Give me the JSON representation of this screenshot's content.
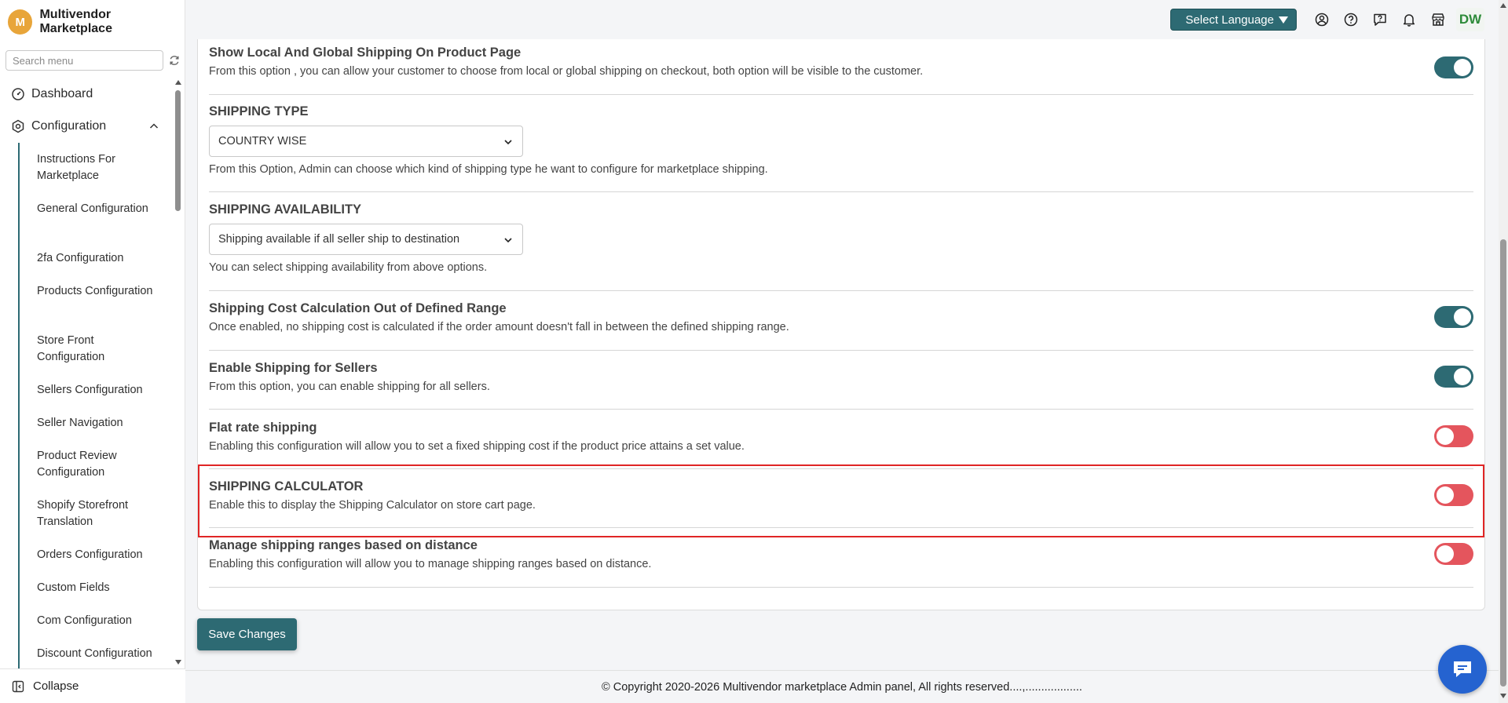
{
  "brand": {
    "logo_letter": "M",
    "name": "Multivendor Marketplace"
  },
  "sidebar": {
    "search_placeholder": "Search menu",
    "dashboard": "Dashboard",
    "configuration": "Configuration",
    "sub_items": [
      "Instructions For Marketplace",
      "General Configuration",
      "2fa Configuration",
      "Products Configuration",
      "Store Front Configuration",
      "Sellers Configuration",
      "Seller Navigation",
      "Product Review Configuration",
      "Shopify Storefront Translation",
      "Orders Configuration",
      "Custom Fields",
      "Com Configuration",
      "Discount Configuration"
    ],
    "collapse": "Collapse"
  },
  "topbar": {
    "language_button": "Select Language",
    "user_initials": "DW",
    "icons": [
      "user-circle-icon",
      "help-circle-icon",
      "support-chat-icon",
      "bell-icon",
      "store-icon"
    ]
  },
  "settings": {
    "local_global": {
      "title": "Show Local And Global Shipping On Product Page",
      "desc": "From this option , you can allow your customer to choose from local or global shipping on checkout, both option will be visible to the customer.",
      "enabled": true
    },
    "shipping_type": {
      "title": "SHIPPING TYPE",
      "value": "COUNTRY WISE",
      "desc": "From this Option, Admin can choose which kind of shipping type he want to configure for marketplace shipping."
    },
    "shipping_availability": {
      "title": "SHIPPING AVAILABILITY",
      "value": "Shipping available if all seller ship to destination",
      "desc": "You can select shipping availability from above options."
    },
    "out_of_range": {
      "title": "Shipping Cost Calculation Out of Defined Range",
      "desc": "Once enabled, no shipping cost is calculated if the order amount doesn't fall in between the defined shipping range.",
      "enabled": true
    },
    "enable_sellers": {
      "title": "Enable Shipping for Sellers",
      "desc": "From this option, you can enable shipping for all sellers.",
      "enabled": true
    },
    "flat_rate": {
      "title": "Flat rate shipping",
      "desc": "Enabling this configuration will allow you to set a fixed shipping cost if the product price attains a set value.",
      "enabled": false
    },
    "calculator": {
      "title": "SHIPPING CALCULATOR",
      "desc": "Enable this to display the Shipping Calculator on store cart page.",
      "enabled": false
    },
    "distance": {
      "title": "Manage shipping ranges based on distance",
      "desc": "Enabling this configuration will allow you to manage shipping ranges based on distance.",
      "enabled": false
    }
  },
  "save_button": "Save Changes",
  "footer": "© Copyright 2020-2026 Multivendor marketplace Admin panel, All rights reserved....,..................",
  "colors": {
    "accent": "#2d6a73",
    "toggle_off": "#e4555d",
    "highlight": "#e02525",
    "chat": "#2563d0"
  }
}
